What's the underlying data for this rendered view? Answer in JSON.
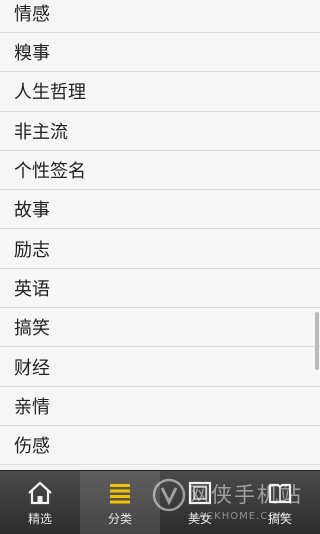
{
  "category_list": {
    "items": [
      {
        "label": "情感"
      },
      {
        "label": "糗事"
      },
      {
        "label": "人生哲理"
      },
      {
        "label": "非主流"
      },
      {
        "label": "个性签名"
      },
      {
        "label": "故事"
      },
      {
        "label": "励志"
      },
      {
        "label": "英语"
      },
      {
        "label": "搞笑"
      },
      {
        "label": "财经"
      },
      {
        "label": "亲情"
      },
      {
        "label": "伤感"
      }
    ]
  },
  "tabbar": {
    "active_tab": "分类",
    "tabs": [
      {
        "label": "精选",
        "icon": "home-icon"
      },
      {
        "label": "分类",
        "icon": "list-icon"
      },
      {
        "label": "美女",
        "icon": "frame-icon"
      },
      {
        "label": "搞笑",
        "icon": "book-icon"
      }
    ]
  },
  "watermark": {
    "text_cn": "网侠手机站",
    "text_en": "HACKHOME.COM"
  },
  "colors": {
    "list_background": "#f6f6f6",
    "divider": "#dcdcdc",
    "tabbar_background": "#3a3a3a",
    "tab_icon_active": "#f2c200",
    "tab_text": "#e6e6e6"
  }
}
